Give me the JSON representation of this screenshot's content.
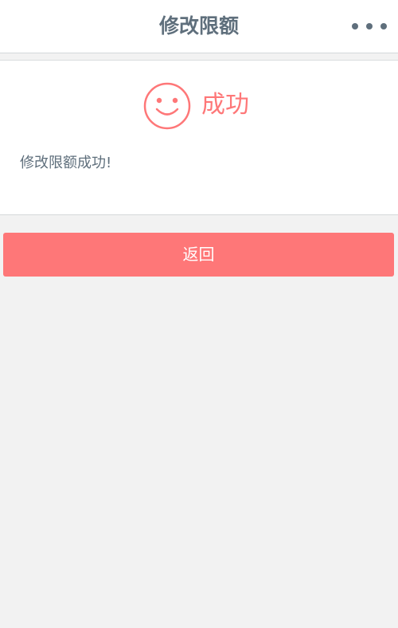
{
  "header": {
    "title": "修改限额",
    "more_icon": "more-horizontal-icon"
  },
  "result": {
    "icon": "smiley-icon",
    "status_label": "成功",
    "message": "修改限额成功!"
  },
  "actions": {
    "back_label": "返回"
  },
  "colors": {
    "accent": "#fe7778",
    "title_text": "#5f6f7c",
    "background": "#f2f2f2"
  }
}
